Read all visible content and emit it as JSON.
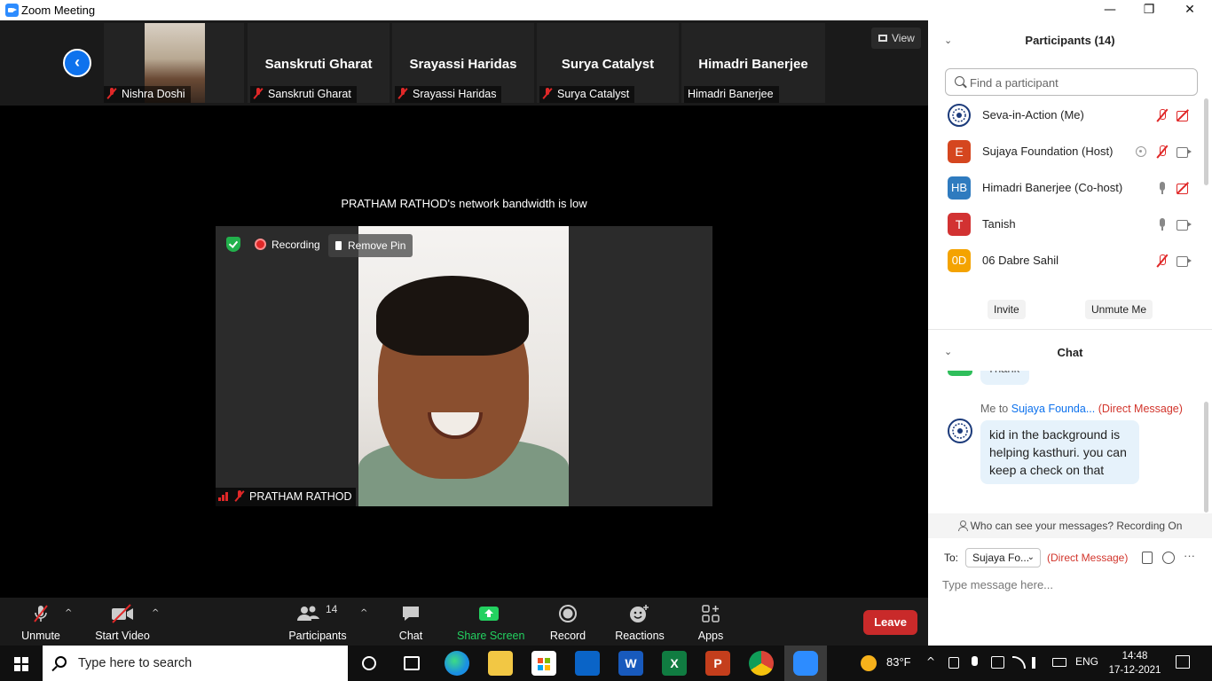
{
  "window": {
    "title": "Zoom Meeting",
    "minimize": "—",
    "restore": "❐",
    "close": "✕"
  },
  "strip": {
    "tiles": [
      {
        "caption": "Nishra Doshi"
      },
      {
        "name": "Sanskruti Gharat",
        "caption": "Sanskruti Gharat"
      },
      {
        "name": "Srayassi Haridas",
        "caption": "Srayassi Haridas"
      },
      {
        "name": "Surya Catalyst",
        "caption": "Surya Catalyst"
      },
      {
        "name": "Himadri Banerjee",
        "caption": "Himadri Banerjee"
      }
    ],
    "view_label": "View",
    "back_glyph": "‹"
  },
  "notice": "PRATHAM RATHOD's network bandwidth is low",
  "main_video": {
    "recording_label": "Recording",
    "remove_pin_label": "Remove Pin",
    "participant_name": "PRATHAM RATHOD"
  },
  "toolbar": {
    "unmute": "Unmute",
    "start_video": "Start Video",
    "participants": "Participants",
    "participants_count": "14",
    "chat": "Chat",
    "share_screen": "Share Screen",
    "record": "Record",
    "reactions": "Reactions",
    "apps": "Apps",
    "leave": "Leave",
    "caret": "^"
  },
  "participants_panel": {
    "title": "Participants (14)",
    "search_placeholder": "Find a participant",
    "people": [
      {
        "initials": "",
        "name": "Seva-in-Action (Me)",
        "color": "#ffffff",
        "mic": "off",
        "video": "off"
      },
      {
        "initials": "E",
        "name": "Sujaya Foundation (Host)",
        "color": "#d5461f",
        "mic": "off",
        "video": "on",
        "recording": true
      },
      {
        "initials": "HB",
        "name": "Himadri Banerjee (Co-host)",
        "color": "#2f7bbf",
        "mic": "on",
        "video": "off"
      },
      {
        "initials": "T",
        "name": "Tanish",
        "color": "#d23232",
        "mic": "on",
        "video": "on"
      },
      {
        "initials": "0D",
        "name": "06 Dabre Sahil",
        "color": "#f4a300",
        "mic": "off",
        "video": "on"
      }
    ],
    "invite": "Invite",
    "unmute_me": "Unmute Me"
  },
  "chat_panel": {
    "title": "Chat",
    "partial_prev_message": "Thank",
    "message": {
      "prefix": "Me to",
      "recipient": "Sujaya Founda...",
      "tag": "(Direct Message)",
      "text": "kid in the background is helping kasthuri. you can keep a check on that"
    },
    "status": "Who can see your messages? Recording On",
    "to_label": "To:",
    "to_value": "Sujaya Fo...",
    "to_tag": "(Direct Message)",
    "more": "···",
    "input_placeholder": "Type message here..."
  },
  "taskbar": {
    "search_placeholder": "Type here to search",
    "weather": "83°F",
    "language": "ENG",
    "time": "14:48",
    "date": "17-12-2021"
  }
}
